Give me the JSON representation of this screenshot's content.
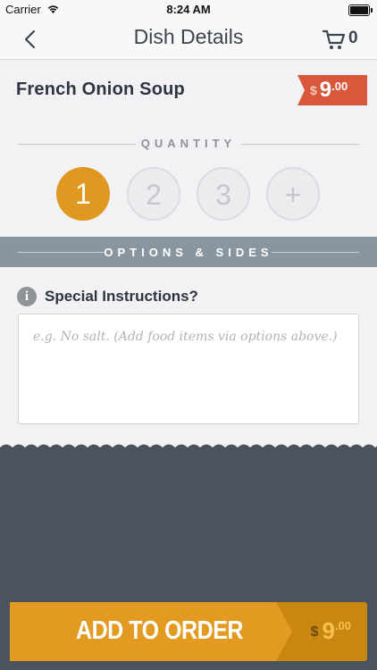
{
  "status_bar": {
    "carrier": "Carrier",
    "time": "8:24 AM"
  },
  "nav": {
    "title": "Dish Details",
    "cart_count": "0"
  },
  "dish": {
    "name": "French Onion Soup",
    "price_currency": "$",
    "price_int": "9",
    "price_cents": ".00",
    "price_tag_color": "#d9573a"
  },
  "quantity": {
    "label": "QUANTITY",
    "options": [
      "1",
      "2",
      "3",
      "+"
    ],
    "selected": "1",
    "accent": "#e09820"
  },
  "options_bar": {
    "label": "OPTIONS & SIDES"
  },
  "instructions": {
    "label": "Special Instructions?",
    "placeholder": "e.g. No salt. (Add food items via options above.)",
    "value": ""
  },
  "add_button": {
    "label": "ADD TO ORDER",
    "price_currency": "$",
    "price_int": "9",
    "price_cents": ".00"
  },
  "icons": [
    "wifi-icon",
    "battery-icon",
    "back-chevron-icon",
    "cart-icon",
    "info-icon"
  ]
}
